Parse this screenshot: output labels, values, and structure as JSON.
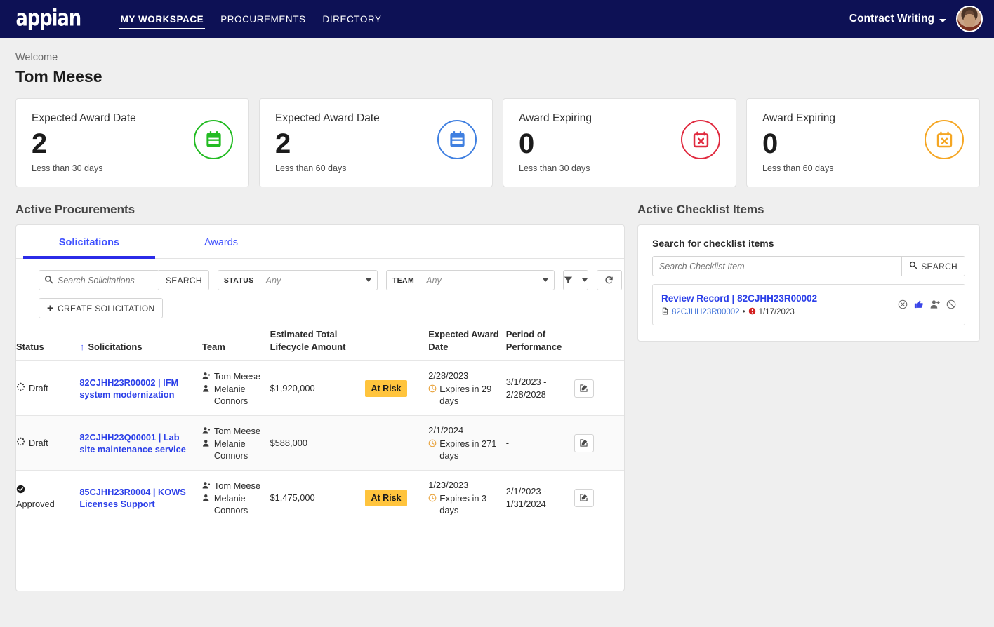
{
  "brand": {
    "logo_text": "appian",
    "navbar_color": "#0D1155",
    "accent": "#2B3FE8"
  },
  "topnav": {
    "links": [
      {
        "label": "MY WORKSPACE",
        "active": true
      },
      {
        "label": "PROCUREMENTS",
        "active": false
      },
      {
        "label": "DIRECTORY",
        "active": false
      }
    ],
    "tenant": "Contract Writing",
    "avatar_name": "user-avatar"
  },
  "welcome": {
    "greeting": "Welcome",
    "name": "Tom Meese"
  },
  "kpi_cards": [
    {
      "title": "Expected Award Date",
      "value": "2",
      "sub": "Less than 30 days",
      "icon": "calendar-icon",
      "color": "#22BB22"
    },
    {
      "title": "Expected Award Date",
      "value": "2",
      "sub": "Less than 60 days",
      "icon": "calendar-icon",
      "color": "#3F7FE0"
    },
    {
      "title": "Award Expiring",
      "value": "0",
      "sub": "Less than 30 days",
      "icon": "calendar-x-icon",
      "color": "#E02A3F"
    },
    {
      "title": "Award Expiring",
      "value": "0",
      "sub": "Less than 60 days",
      "icon": "calendar-x-icon",
      "color": "#F5A623"
    }
  ],
  "procurements": {
    "section_title": "Active Procurements",
    "tabs": [
      {
        "label": "Solicitations",
        "active": true
      },
      {
        "label": "Awards",
        "active": false
      }
    ],
    "search": {
      "placeholder": "Search Solicitations",
      "value": "",
      "button": "SEARCH"
    },
    "status_filter": {
      "label": "STATUS",
      "value": "Any"
    },
    "team_filter": {
      "label": "TEAM",
      "value": "Any"
    },
    "filter_button": "filter-icon",
    "refresh_button": "refresh-icon",
    "create_button": "CREATE SOLICITATION",
    "columns": [
      "Status",
      "Solicitations",
      "Team",
      "Estimated Total Lifecycle Amount",
      "",
      "Expected Award Date",
      "Period of Performance",
      ""
    ],
    "sort_column": "Status",
    "sort_direction": "ascending",
    "rows": [
      {
        "status": "Draft",
        "status_icon": "spinner-icon",
        "solicitation": "82CJHH23R00002 | IFM system modernization",
        "team": [
          "Tom Meese",
          "Melanie Connors"
        ],
        "amount": "$1,920,000",
        "risk_badge": "At Risk",
        "award_date": "2/28/2023",
        "expires": "Expires in 29 days",
        "period": "3/1/2023 - 2/28/2028",
        "action": "edit-icon"
      },
      {
        "status": "Draft",
        "status_icon": "spinner-icon",
        "solicitation": "82CJHH23Q00001 | Lab site maintenance service",
        "team": [
          "Tom Meese",
          "Melanie Connors"
        ],
        "amount": "$588,000",
        "risk_badge": "",
        "award_date": "2/1/2024",
        "expires": "Expires in 271 days",
        "period": "-",
        "action": "edit-icon"
      },
      {
        "status": "Approved",
        "status_icon": "check-circle-icon",
        "solicitation": "85CJHH23R0004 | KOWS Licenses Support",
        "team": [
          "Tom Meese",
          "Melanie Connors"
        ],
        "amount": "$1,475,000",
        "risk_badge": "At Risk",
        "award_date": "1/23/2023",
        "expires": "Expires in 3 days",
        "period": "2/1/2023 - 1/31/2024",
        "action": "edit-icon"
      }
    ]
  },
  "checklist": {
    "section_title": "Active Checklist Items",
    "panel_title": "Search for checklist items",
    "search": {
      "placeholder": "Search Checklist Item",
      "value": "",
      "button": "SEARCH"
    },
    "items": [
      {
        "title": "Review Record | 82CJHH23R00002",
        "record": "82CJHH23R00002",
        "separator": "•",
        "date": "1/17/2023",
        "priority_icon": "priority-high-icon",
        "doc_icon": "document-icon",
        "actions": [
          "reject-circle-icon",
          "thumbs-up-icon",
          "assign-user-icon",
          "block-icon"
        ]
      }
    ]
  }
}
